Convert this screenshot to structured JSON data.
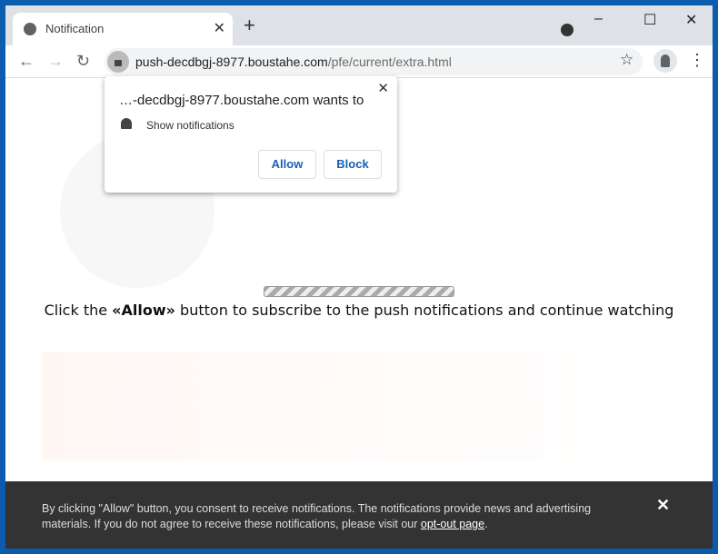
{
  "tab": {
    "title": "Notification"
  },
  "window_controls": {
    "minimize": "–",
    "maximize": "☐",
    "close": "✕"
  },
  "address": {
    "host": "push-decdbgj-8977.boustahe.com",
    "path": "/pfe/current/extra.html"
  },
  "popup": {
    "origin": "…-decdbgj-8977.boustahe.com wants to",
    "permission": "Show notifications",
    "allow": "Allow",
    "block": "Block"
  },
  "page": {
    "msg_before": "Click the ",
    "msg_bold": "«Allow»",
    "msg_after": " button to subscribe to the push notifications and continue watching"
  },
  "banner": {
    "text": "By clicking \"Allow\" button, you consent to receive notifications. The notifications provide news and advertising materials. If you do not agree to receive these notifications, please visit our ",
    "link": "opt-out page",
    "end": "."
  },
  "colors": {
    "frame": "#0b5cad",
    "banner": "#333333",
    "button_text": "#1a5fb4"
  }
}
